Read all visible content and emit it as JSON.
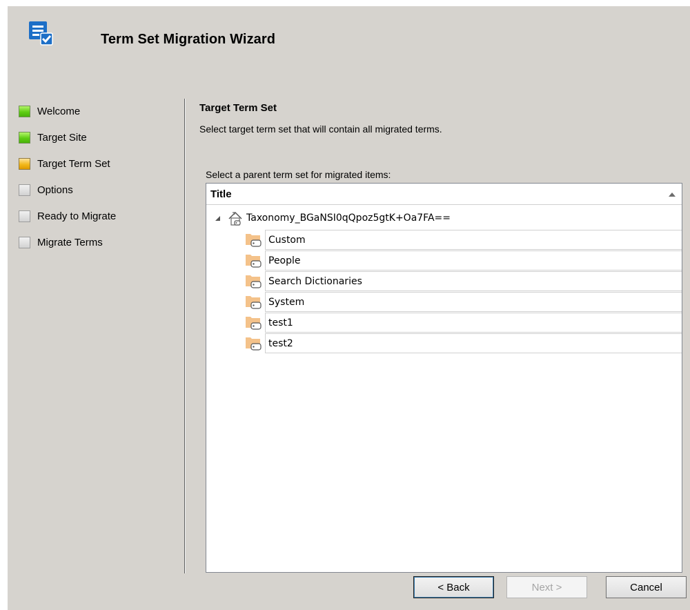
{
  "window": {
    "title": "Term Set Migration Wizard",
    "icon": "wizard-list-check-icon"
  },
  "steps": [
    {
      "label": "Welcome",
      "status": "done"
    },
    {
      "label": "Target Site",
      "status": "done"
    },
    {
      "label": "Target Term Set",
      "status": "current"
    },
    {
      "label": "Options",
      "status": "pending"
    },
    {
      "label": "Ready to Migrate",
      "status": "pending"
    },
    {
      "label": "Migrate Terms",
      "status": "pending"
    }
  ],
  "page": {
    "title": "Target Term Set",
    "description": "Select target term set that will contain all migrated terms.",
    "tree_label": "Select a parent term set for migrated items:"
  },
  "tree": {
    "column_header": "Title",
    "root": {
      "label": "Taxonomy_BGaNSI0qQpoz5gtK+Oa7FA==",
      "icon": "term-store-icon",
      "expanded": true
    },
    "children": [
      {
        "label": "Custom",
        "icon": "term-group-icon"
      },
      {
        "label": "People",
        "icon": "term-group-icon"
      },
      {
        "label": "Search Dictionaries",
        "icon": "term-group-icon"
      },
      {
        "label": "System",
        "icon": "term-group-icon"
      },
      {
        "label": "test1",
        "icon": "term-group-icon"
      },
      {
        "label": "test2",
        "icon": "term-group-icon"
      }
    ]
  },
  "buttons": {
    "back": "< Back",
    "next": "Next >",
    "cancel": "Cancel"
  },
  "colors": {
    "dialog_bg": "#d6d3ce",
    "step_done": "#5fce14",
    "step_current": "#f2b81c",
    "step_pending": "#d2d2d2"
  }
}
